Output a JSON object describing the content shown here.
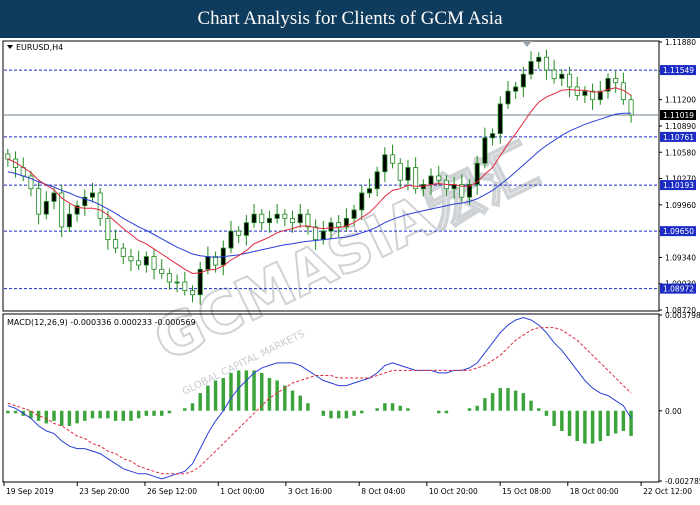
{
  "header": {
    "title": "Chart Analysis for Clients of GCM Asia"
  },
  "watermark": {
    "text": "GCMASIA宏汇",
    "subtext": "GLOBAL CAPITAL MARKETS"
  },
  "colors": {
    "banner": "#0f3b5c",
    "candle": "#1f8a1f",
    "ma_fast": "#e0283c",
    "ma_slow": "#2a3fd8",
    "level_line": "#1c2bc4",
    "label_bg": "#1c2bc4",
    "macd_line": "#2a3fd8",
    "signal_line": "#e0283c",
    "histogram": "#3aa43a"
  },
  "chart_data": [
    {
      "type": "candlestick",
      "symbol_label": "EURUSD,H4",
      "ylim": [
        1.0872,
        1.1188
      ],
      "y_ticks": [
        "1.11880",
        "1.11540",
        "1.11200",
        "1.10890",
        "1.10580",
        "1.10270",
        "1.09960",
        "1.09650",
        "1.09340",
        "1.09030",
        "1.08720"
      ],
      "current_price": "1.11019",
      "levels": [
        "1.11549",
        "1.10761",
        "1.10193",
        "1.09650",
        "1.08972"
      ],
      "x_ticks": [
        "19 Sep 2019",
        "23 Sep 20:00",
        "26 Sep 12:00",
        "1 Oct 00:00",
        "3 Oct 16:00",
        "8 Oct 04:00",
        "10 Oct 20:00",
        "15 Oct 08:00",
        "18 Oct 00:00",
        "22 Oct 12:00"
      ],
      "closes": [
        1.105,
        1.104,
        1.103,
        1.1015,
        1.0985,
        1.1,
        1.101,
        1.097,
        1.0985,
        1.0995,
        1.1005,
        1.101,
        1.098,
        1.0955,
        1.0945,
        1.0935,
        1.093,
        1.0925,
        1.0935,
        1.092,
        1.0915,
        1.0905,
        1.0905,
        1.0895,
        1.089,
        1.092,
        1.0935,
        1.0925,
        1.0945,
        1.0965,
        1.096,
        1.0975,
        1.0985,
        1.0975,
        1.098,
        1.0985,
        1.098,
        1.0975,
        1.0985,
        1.097,
        1.0955,
        1.0965,
        1.0975,
        1.097,
        1.098,
        1.099,
        1.101,
        1.1015,
        1.1035,
        1.1055,
        1.1045,
        1.1025,
        1.104,
        1.1015,
        1.102,
        1.103,
        1.1025,
        1.1015,
        1.102,
        1.1005,
        1.102,
        1.1045,
        1.1075,
        1.108,
        1.1115,
        1.113,
        1.1135,
        1.115,
        1.1165,
        1.117,
        1.1155,
        1.1145,
        1.115,
        1.1135,
        1.1125,
        1.113,
        1.112,
        1.113,
        1.1145,
        1.114,
        1.112,
        1.1102
      ],
      "ma_fast": [
        1.105,
        1.1046,
        1.104,
        1.1034,
        1.1025,
        1.1019,
        1.1014,
        1.1004,
        1.0998,
        1.0993,
        1.0992,
        1.0992,
        1.099,
        1.0984,
        1.0976,
        1.0968,
        1.0961,
        1.0954,
        1.095,
        1.0944,
        1.0938,
        1.0932,
        1.0926,
        1.092,
        1.0915,
        1.0916,
        1.0919,
        1.092,
        1.0924,
        1.0931,
        1.0936,
        1.0942,
        1.095,
        1.0954,
        1.0958,
        1.0963,
        1.0966,
        1.0968,
        1.0971,
        1.0971,
        1.0969,
        1.0968,
        1.0969,
        1.0969,
        1.0971,
        1.0975,
        1.0981,
        1.0987,
        1.0996,
        1.1006,
        1.1013,
        1.1015,
        1.1019,
        1.1018,
        1.1018,
        1.102,
        1.1021,
        1.102,
        1.102,
        1.1018,
        1.1018,
        1.1023,
        1.1032,
        1.104,
        1.1054,
        1.1068,
        1.108,
        1.1093,
        1.1106,
        1.1117,
        1.1123,
        1.1127,
        1.1131,
        1.1132,
        1.1131,
        1.1131,
        1.1129,
        1.1129,
        1.1132,
        1.1134,
        1.1131,
        1.1125
      ],
      "ma_slow": [
        1.1035,
        1.1033,
        1.103,
        1.1027,
        1.1023,
        1.102,
        1.1017,
        1.1013,
        1.101,
        1.1006,
        1.1003,
        1.1,
        1.0996,
        1.0991,
        1.0986,
        1.098,
        1.0975,
        1.097,
        1.0966,
        1.0961,
        1.0956,
        1.0951,
        1.0946,
        1.0942,
        1.0938,
        1.0936,
        1.0935,
        1.0934,
        1.0935,
        1.0936,
        1.0937,
        1.0939,
        1.0941,
        1.0943,
        1.0945,
        1.0947,
        1.0949,
        1.095,
        1.0952,
        1.0953,
        1.0954,
        1.0955,
        1.0956,
        1.0957,
        1.0958,
        1.096,
        1.0963,
        1.0966,
        1.097,
        1.0975,
        1.0979,
        1.0982,
        1.0985,
        1.0987,
        1.0989,
        1.0991,
        1.0993,
        1.0995,
        1.0997,
        1.0998,
        1.1,
        1.1003,
        1.1008,
        1.1013,
        1.102,
        1.1027,
        1.1035,
        1.1043,
        1.1051,
        1.1059,
        1.1066,
        1.1072,
        1.1078,
        1.1083,
        1.1087,
        1.1091,
        1.1094,
        1.1097,
        1.11,
        1.1103,
        1.1104,
        1.1104
      ]
    },
    {
      "type": "macd",
      "label": "MACD(12,26,9) -0.000336 0.000233 -0.000569",
      "ylim": [
        -0.002785,
        0.003798
      ],
      "y_ticks": [
        "0.003798",
        "0.00",
        "-0.002785"
      ],
      "macd": [
        0.0002,
        0.0001,
        -0.0001,
        -0.0003,
        -0.0006,
        -0.0008,
        -0.0009,
        -0.0012,
        -0.0014,
        -0.0015,
        -0.0015,
        -0.0016,
        -0.0017,
        -0.0019,
        -0.0021,
        -0.0023,
        -0.0024,
        -0.0025,
        -0.0025,
        -0.0026,
        -0.0027,
        -0.0026,
        -0.0025,
        -0.0024,
        -0.0021,
        -0.0015,
        -0.0009,
        -0.0004,
        0.0,
        0.0005,
        0.0009,
        0.0012,
        0.0015,
        0.0017,
        0.0018,
        0.0019,
        0.0019,
        0.0019,
        0.0018,
        0.0016,
        0.0014,
        0.0012,
        0.0011,
        0.001,
        0.001,
        0.0011,
        0.0012,
        0.0013,
        0.0015,
        0.0018,
        0.0019,
        0.0018,
        0.0017,
        0.0016,
        0.0016,
        0.0016,
        0.0015,
        0.0015,
        0.0016,
        0.0016,
        0.0017,
        0.0019,
        0.0023,
        0.0027,
        0.0031,
        0.0034,
        0.0036,
        0.0037,
        0.0036,
        0.0034,
        0.0031,
        0.0027,
        0.0024,
        0.002,
        0.0016,
        0.0012,
        0.0009,
        0.0007,
        0.0006,
        0.0004,
        0.0002,
        -0.0003
      ],
      "signal": [
        0.0003,
        0.0002,
        0.0001,
        0.0,
        -0.0002,
        -0.0003,
        -0.0005,
        -0.0006,
        -0.0008,
        -0.001,
        -0.0011,
        -0.0013,
        -0.0014,
        -0.0016,
        -0.0017,
        -0.0019,
        -0.002,
        -0.0022,
        -0.0023,
        -0.0024,
        -0.0025,
        -0.0025,
        -0.0025,
        -0.0025,
        -0.0024,
        -0.0022,
        -0.0019,
        -0.0016,
        -0.0013,
        -0.001,
        -0.0007,
        -0.0004,
        -0.0001,
        0.0002,
        0.0005,
        0.0007,
        0.0009,
        0.0011,
        0.0012,
        0.0013,
        0.0014,
        0.0014,
        0.0014,
        0.0013,
        0.0013,
        0.0013,
        0.0013,
        0.0013,
        0.0014,
        0.0015,
        0.0016,
        0.0016,
        0.0016,
        0.0016,
        0.0016,
        0.0016,
        0.0016,
        0.0016,
        0.0016,
        0.0016,
        0.0016,
        0.0017,
        0.0018,
        0.002,
        0.0022,
        0.0025,
        0.0028,
        0.003,
        0.0032,
        0.0033,
        0.0033,
        0.0033,
        0.0032,
        0.003,
        0.0028,
        0.0025,
        0.0022,
        0.0019,
        0.0016,
        0.0013,
        0.001,
        0.0007
      ]
    }
  ]
}
